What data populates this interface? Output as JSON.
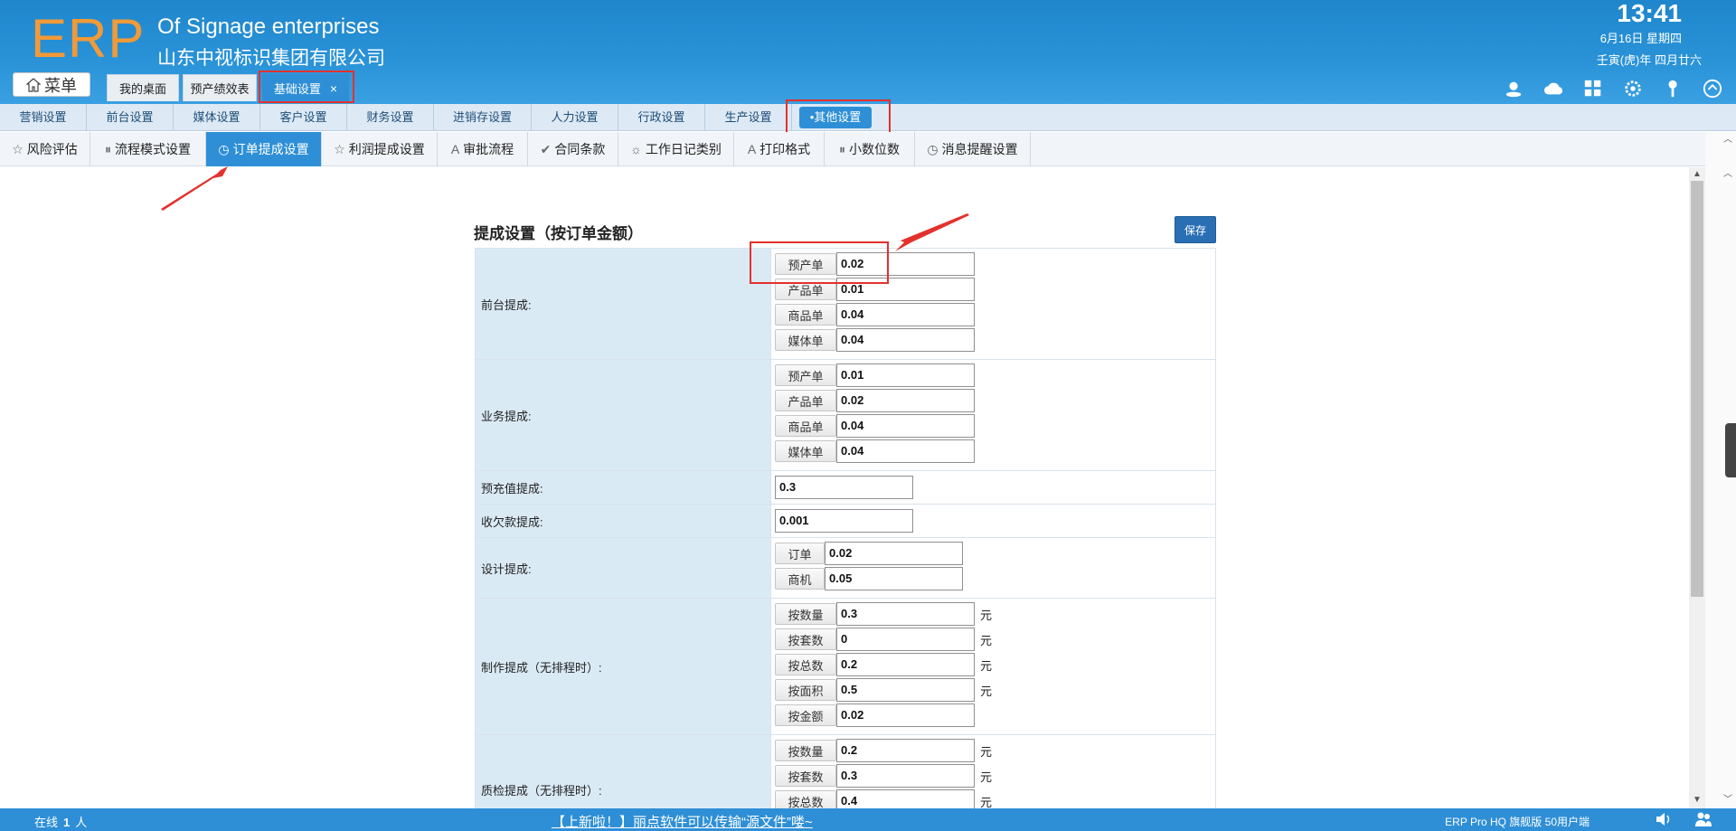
{
  "header": {
    "logo": "ERP",
    "company_en": "Of Signage enterprises",
    "company_cn": "山东中视标识集团有限公司",
    "time": "13:41",
    "date": "6月16日 星期四",
    "lunar": "壬寅(虎)年 四月廿六",
    "menu_label": "菜单",
    "icons": [
      "user-icon",
      "cloud-icon",
      "apps-icon",
      "gear-icon",
      "key-icon",
      "collapse-up-icon"
    ]
  },
  "tabs": [
    {
      "label": "我的桌面"
    },
    {
      "label": "预产绩效表"
    },
    {
      "label": "基础设置",
      "close": "×"
    }
  ],
  "nav1": [
    "营销设置",
    "前台设置",
    "媒体设置",
    "客户设置",
    "财务设置",
    "进销存设置",
    "人力设置",
    "行政设置",
    "生产设置",
    "•其他设置"
  ],
  "nav2": [
    {
      "icon": "☆",
      "label": "风险评估"
    },
    {
      "icon": "⏸",
      "label": "流程模式设置"
    },
    {
      "icon": "◷",
      "label": "订单提成设置"
    },
    {
      "icon": "☆",
      "label": "利润提成设置"
    },
    {
      "icon": "A",
      "label": "审批流程"
    },
    {
      "icon": "✔",
      "label": "合同条款"
    },
    {
      "icon": "☼",
      "label": "工作日记类别"
    },
    {
      "icon": "A",
      "label": "打印格式"
    },
    {
      "icon": "⏸",
      "label": "小数位数"
    },
    {
      "icon": "◷",
      "label": "消息提醒设置"
    }
  ],
  "form": {
    "title": "提成设置（按订单金额）",
    "save": "保存",
    "rows": [
      {
        "label": "前台提成:",
        "pairs": [
          {
            "k": "预产单",
            "v": "0.02"
          },
          {
            "k": "产品单",
            "v": "0.01"
          },
          {
            "k": "商品单",
            "v": "0.04"
          },
          {
            "k": "媒体单",
            "v": "0.04"
          }
        ]
      },
      {
        "label": "业务提成:",
        "pairs": [
          {
            "k": "预产单",
            "v": "0.01"
          },
          {
            "k": "产品单",
            "v": "0.02"
          },
          {
            "k": "商品单",
            "v": "0.04"
          },
          {
            "k": "媒体单",
            "v": "0.04"
          }
        ]
      },
      {
        "label": "预充值提成:",
        "single": "0.3"
      },
      {
        "label": "收欠款提成:",
        "single": "0.001"
      },
      {
        "label": "设计提成:",
        "pairs": [
          {
            "k": "订单",
            "v": "0.02"
          },
          {
            "k": "商机",
            "v": "0.05"
          }
        ]
      },
      {
        "label": "制作提成（无排程时）:",
        "pairs": [
          {
            "k": "按数量",
            "v": "0.3",
            "u": "元"
          },
          {
            "k": "按套数",
            "v": "0",
            "u": "元"
          },
          {
            "k": "按总数",
            "v": "0.2",
            "u": "元"
          },
          {
            "k": "按面积",
            "v": "0.5",
            "u": "元"
          },
          {
            "k": "按金额",
            "v": "0.02"
          }
        ]
      },
      {
        "label": "质检提成（无排程时）:",
        "pairs": [
          {
            "k": "按数量",
            "v": "0.2",
            "u": "元"
          },
          {
            "k": "按套数",
            "v": "0.3",
            "u": "元"
          },
          {
            "k": "按总数",
            "v": "0.4",
            "u": "元"
          }
        ]
      }
    ]
  },
  "footer": {
    "online_prefix": "在线",
    "online_count": "1",
    "online_suffix": "人",
    "notice": "【上新啦！】丽点软件可以传输“源文件”喽~",
    "version": "ERP Pro HQ 旗舰版 50用户端"
  },
  "colors": {
    "header_blue": "#2a93d8",
    "logo_orange": "#f29a38",
    "active_blue": "#2e8fd6",
    "label_bg": "#daeaf5",
    "highlight_red": "#e3312d"
  }
}
